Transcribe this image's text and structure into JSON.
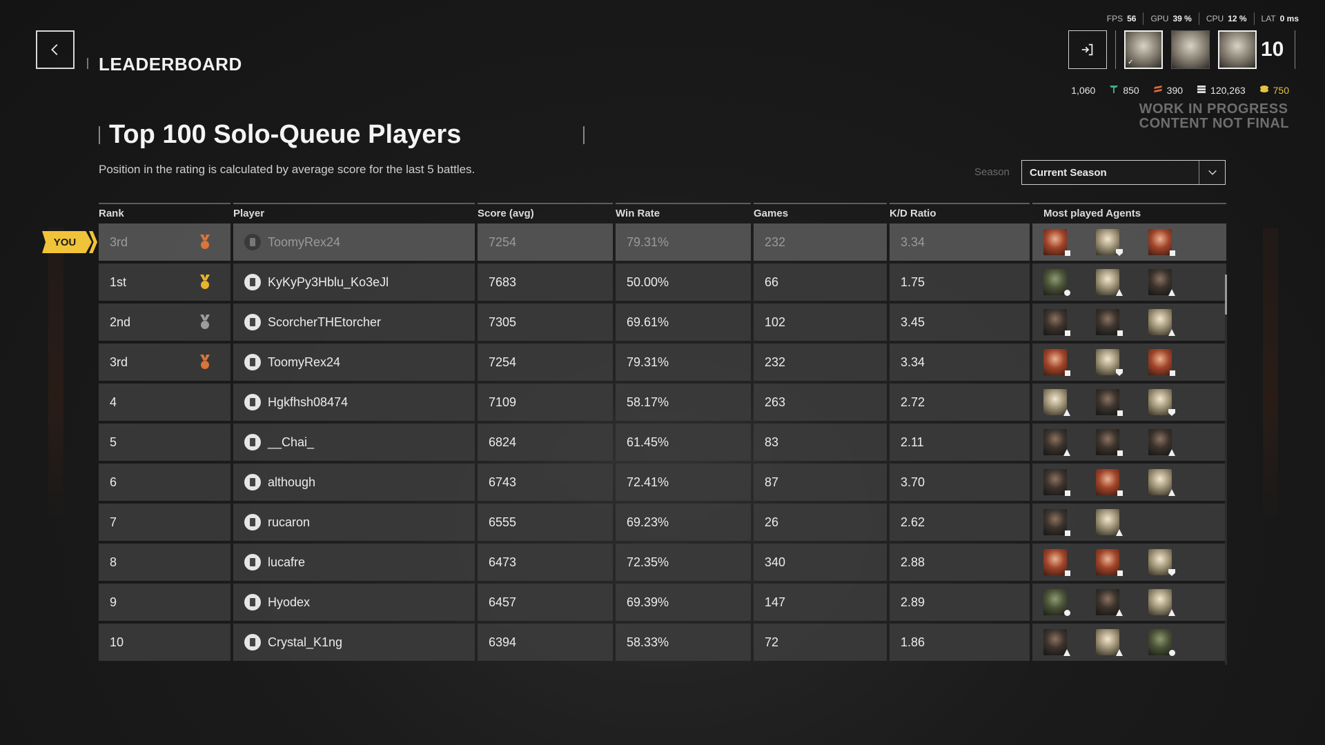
{
  "header": {
    "title": "LEADERBOARD",
    "back_icon": "chevron-left-icon"
  },
  "perf": {
    "fps_label": "FPS",
    "fps": "56",
    "gpu_label": "GPU",
    "gpu": "39 %",
    "cpu_label": "CPU",
    "cpu": "12 %",
    "lat_label": "LAT",
    "lat": "0 ms"
  },
  "squad": {
    "count": "10",
    "exit_icon": "exit-icon",
    "portraits": 3
  },
  "currency": [
    {
      "name": "crescent-currency",
      "value": "1,060",
      "color": "#4a7fe0"
    },
    {
      "name": "emblem-currency",
      "value": "850",
      "color": "#3fae8e"
    },
    {
      "name": "stripe-currency",
      "value": "390",
      "color": "#e06a3b"
    },
    {
      "name": "credits-currency",
      "value": "120,263",
      "color": "#dcdcdc"
    },
    {
      "name": "gold-currency",
      "value": "750",
      "color": "#e3c343"
    }
  ],
  "wip": {
    "line1": "WORK IN PROGRESS",
    "line2": "CONTENT NOT FINAL"
  },
  "board": {
    "title": "Top 100 Solo-Queue Players",
    "subtitle": "Position in the rating is calculated by average score for the last 5 battles.",
    "season_label": "Season",
    "season_value": "Current Season",
    "you_label": "YOU"
  },
  "columns": [
    "Rank",
    "Player",
    "Score (avg)",
    "Win Rate",
    "Games",
    "K/D Ratio",
    "Most played Agents"
  ],
  "me": {
    "rank": "3rd",
    "medal": "bronze",
    "player": "ToomyRex24",
    "score": "7254",
    "win": "79.31%",
    "games": "232",
    "kd": "3.34",
    "agents": [
      [
        "red",
        "sq"
      ],
      [
        "tan",
        "sh"
      ],
      [
        "red",
        "sq"
      ]
    ]
  },
  "rows": [
    {
      "rank": "1st",
      "medal": "gold",
      "player": "KyKyPy3Hblu_Ko3eJl",
      "score": "7683",
      "win": "50.00%",
      "games": "66",
      "kd": "1.75",
      "agents": [
        [
          "green",
          "dot"
        ],
        [
          "tan",
          "up"
        ],
        [
          "dark",
          "up"
        ]
      ]
    },
    {
      "rank": "2nd",
      "medal": "silver",
      "player": "ScorcherTHEtorcher",
      "score": "7305",
      "win": "69.61%",
      "games": "102",
      "kd": "3.45",
      "agents": [
        [
          "dark",
          "sq"
        ],
        [
          "dark",
          "sq"
        ],
        [
          "tan",
          "up"
        ]
      ]
    },
    {
      "rank": "3rd",
      "medal": "bronze",
      "player": "ToomyRex24",
      "score": "7254",
      "win": "79.31%",
      "games": "232",
      "kd": "3.34",
      "agents": [
        [
          "red",
          "sq"
        ],
        [
          "tan",
          "sh"
        ],
        [
          "red",
          "sq"
        ]
      ]
    },
    {
      "rank": "4",
      "medal": "",
      "player": "Hgkfhsh08474",
      "score": "7109",
      "win": "58.17%",
      "games": "263",
      "kd": "2.72",
      "agents": [
        [
          "tan",
          "up"
        ],
        [
          "dark",
          "sq"
        ],
        [
          "tan",
          "sh"
        ]
      ]
    },
    {
      "rank": "5",
      "medal": "",
      "player": "__Chai_",
      "score": "6824",
      "win": "61.45%",
      "games": "83",
      "kd": "2.11",
      "agents": [
        [
          "dark",
          "up"
        ],
        [
          "dark",
          "sq"
        ],
        [
          "dark",
          "up"
        ]
      ]
    },
    {
      "rank": "6",
      "medal": "",
      "player": "although",
      "score": "6743",
      "win": "72.41%",
      "games": "87",
      "kd": "3.70",
      "agents": [
        [
          "dark",
          "sq"
        ],
        [
          "red",
          "sq"
        ],
        [
          "tan",
          "up"
        ]
      ]
    },
    {
      "rank": "7",
      "medal": "",
      "player": "rucaron",
      "score": "6555",
      "win": "69.23%",
      "games": "26",
      "kd": "2.62",
      "agents": [
        [
          "dark",
          "sq"
        ],
        [
          "tan",
          "up"
        ]
      ]
    },
    {
      "rank": "8",
      "medal": "",
      "player": "lucafre",
      "score": "6473",
      "win": "72.35%",
      "games": "340",
      "kd": "2.88",
      "agents": [
        [
          "red",
          "sq"
        ],
        [
          "red",
          "sq"
        ],
        [
          "tan",
          "sh"
        ]
      ]
    },
    {
      "rank": "9",
      "medal": "",
      "player": "Hyodex",
      "score": "6457",
      "win": "69.39%",
      "games": "147",
      "kd": "2.89",
      "agents": [
        [
          "green",
          "dot"
        ],
        [
          "dark",
          "up"
        ],
        [
          "tan",
          "up"
        ]
      ]
    },
    {
      "rank": "10",
      "medal": "",
      "player": "Crystal_K1ng",
      "score": "6394",
      "win": "58.33%",
      "games": "72",
      "kd": "1.86",
      "agents": [
        [
          "dark",
          "up"
        ],
        [
          "tan",
          "up"
        ],
        [
          "green",
          "dot"
        ]
      ]
    }
  ],
  "medal_colors": {
    "gold": "#e9b42e",
    "silver": "#9c9c9c",
    "bronze": "#d9743a"
  }
}
